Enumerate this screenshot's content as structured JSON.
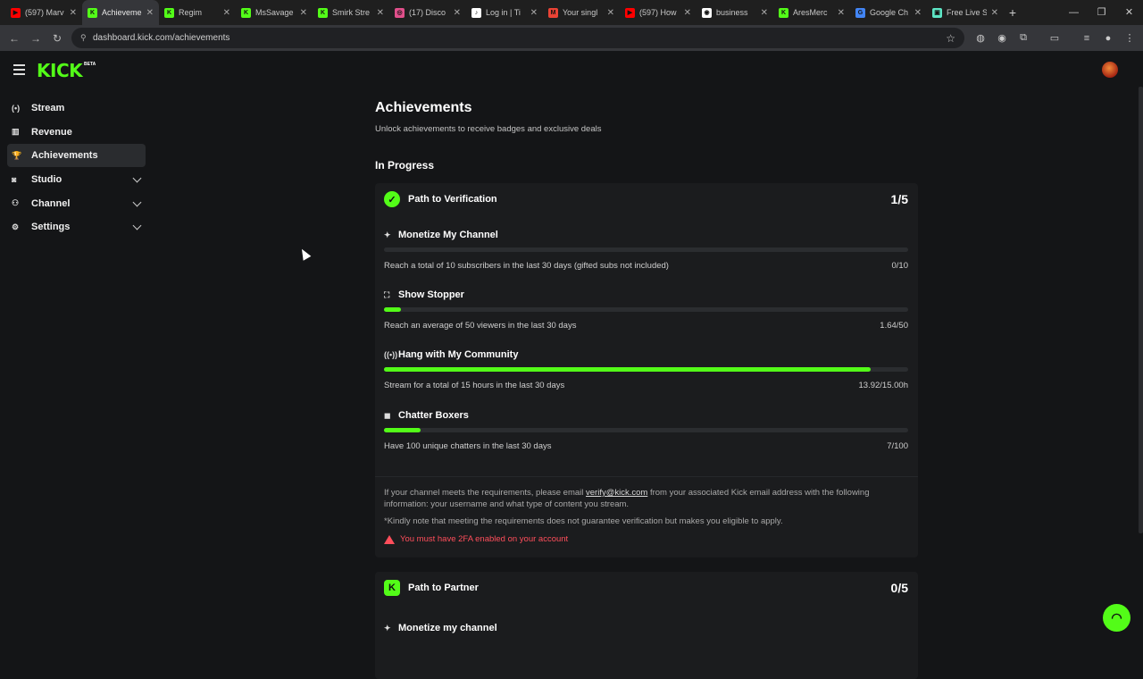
{
  "browser": {
    "tabs": [
      {
        "title": "(597) Marv",
        "color": "#ff0000",
        "glyph": "▶"
      },
      {
        "title": "Achieveme",
        "color": "#53fc18",
        "glyph": "K",
        "active": true
      },
      {
        "title": "Regim",
        "color": "#53fc18",
        "glyph": "K"
      },
      {
        "title": "MsSavage",
        "color": "#53fc18",
        "glyph": "K"
      },
      {
        "title": "Smirk Stre",
        "color": "#53fc18",
        "glyph": "K"
      },
      {
        "title": "(17) Disco",
        "color": "#e14f8b",
        "glyph": "◎"
      },
      {
        "title": "Log in | Ti",
        "color": "#ffffff",
        "glyph": "♪"
      },
      {
        "title": "Your singl",
        "color": "#ea4335",
        "glyph": "M"
      },
      {
        "title": "(597) How",
        "color": "#ff0000",
        "glyph": "▶"
      },
      {
        "title": "business",
        "color": "#ffffff",
        "glyph": "◉"
      },
      {
        "title": "AresMerc",
        "color": "#53fc18",
        "glyph": "K"
      },
      {
        "title": "Google Ch",
        "color": "#4285f4",
        "glyph": "G"
      },
      {
        "title": "Free Live S",
        "color": "#5de5c5",
        "glyph": "▣"
      }
    ],
    "new_tab": "+",
    "url": "dashboard.kick.com/achievements",
    "window_controls": [
      "—",
      "❐",
      "✕"
    ]
  },
  "app": {
    "logo": "KICK",
    "beta": "BETA"
  },
  "sidebar": {
    "items": [
      {
        "label": "Stream",
        "icon": "broadcast-icon",
        "glyph": "(•)"
      },
      {
        "label": "Revenue",
        "icon": "chart-icon",
        "glyph": "▥"
      },
      {
        "label": "Achievements",
        "icon": "trophy-icon",
        "glyph": "🏆",
        "active": true
      },
      {
        "label": "Studio",
        "icon": "studio-icon",
        "glyph": "◙",
        "expandable": true
      },
      {
        "label": "Channel",
        "icon": "users-icon",
        "glyph": "⚇",
        "expandable": true
      },
      {
        "label": "Settings",
        "icon": "gear-icon",
        "glyph": "⚙",
        "expandable": true
      }
    ]
  },
  "main": {
    "title": "Achievements",
    "subtitle": "Unlock achievements to receive badges and exclusive deals",
    "section": "In Progress",
    "verification": {
      "title": "Path to Verification",
      "count": "1/5",
      "achievements": [
        {
          "title": "Monetize My Channel",
          "icon": "sparkle-icon",
          "glyph": "✦",
          "desc": "Reach a total of 10 subscribers in the last 30 days (gifted subs not included)",
          "progress": "0/10",
          "fraction": 0.0
        },
        {
          "title": "Show Stopper",
          "icon": "viewers-icon",
          "glyph": "⛶",
          "desc": "Reach an average of 50 viewers in the last 30 days",
          "progress": "1.64/50",
          "fraction": 0.033
        },
        {
          "title": "Hang with My Community",
          "icon": "broadcast-icon",
          "glyph": "((•))",
          "desc": "Stream for a total of 15 hours in the last 30 days",
          "progress": "13.92/15.00h",
          "fraction": 0.928
        },
        {
          "title": "Chatter Boxers",
          "icon": "chat-icon",
          "glyph": "◼",
          "desc": "Have 100 unique chatters in the last 30 days",
          "progress": "7/100",
          "fraction": 0.07
        }
      ],
      "note_prefix": "If your channel meets the requirements, please email ",
      "note_email": "verify@kick.com",
      "note_suffix": " from your associated Kick email address with the following information: your username and what type of content you stream.",
      "note_disclaimer": "*Kindly note that meeting the requirements does not guarantee verification but makes you eligible to apply.",
      "warning": "You must have 2FA enabled on your account"
    },
    "partner": {
      "title": "Path to Partner",
      "count": "0/5",
      "first_achievement": "Monetize my channel"
    }
  },
  "colors": {
    "accent": "#53fc18",
    "warning": "#ff4e5b",
    "background": "#141517",
    "card": "#1b1c1e"
  }
}
